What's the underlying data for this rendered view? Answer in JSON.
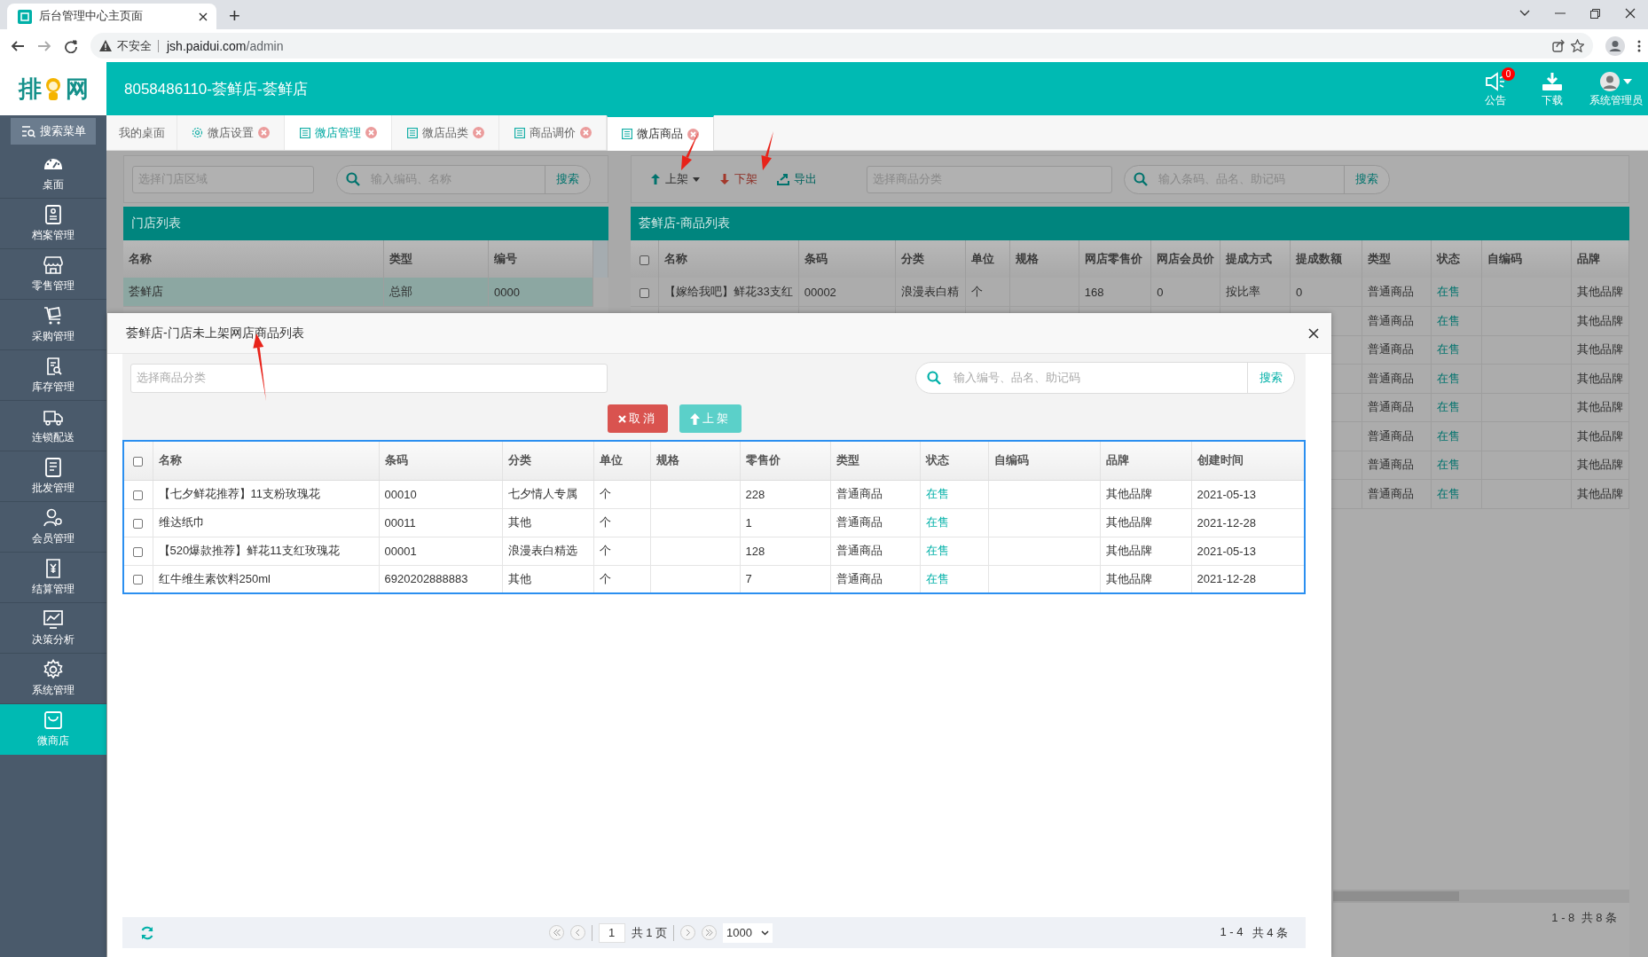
{
  "browser": {
    "tab_title": "后台管理中心主页面",
    "new_tab": "+",
    "security_label": "不安全",
    "url_host": "jsh.paidui.com",
    "url_path": "/admin"
  },
  "header": {
    "logo": [
      "排",
      "网"
    ],
    "title": "8058486110-荟鲜店-荟鲜店",
    "actions": [
      {
        "kind": "notice",
        "label": "公告",
        "badge": "0"
      },
      {
        "kind": "download",
        "label": "下载"
      },
      {
        "kind": "user",
        "label": "系统管理员"
      }
    ]
  },
  "sidebar": {
    "search_button": "搜索菜单",
    "items": [
      {
        "label": "桌面",
        "selected": false
      },
      {
        "label": "档案管理",
        "selected": false
      },
      {
        "label": "零售管理",
        "selected": false
      },
      {
        "label": "采购管理",
        "selected": false
      },
      {
        "label": "库存管理",
        "selected": false
      },
      {
        "label": "连锁配送",
        "selected": false
      },
      {
        "label": "批发管理",
        "selected": false
      },
      {
        "label": "会员管理",
        "selected": false
      },
      {
        "label": "结算管理",
        "selected": false
      },
      {
        "label": "决策分析",
        "selected": false
      },
      {
        "label": "系统管理",
        "selected": false
      },
      {
        "label": "微商店",
        "selected": true
      }
    ]
  },
  "tabs": [
    {
      "label": "我的桌面",
      "selected": false,
      "highlighted": false,
      "closable": false
    },
    {
      "label": "微店设置",
      "selected": false,
      "highlighted": false,
      "closable": true
    },
    {
      "label": "微店管理",
      "selected": false,
      "highlighted": true,
      "closable": true
    },
    {
      "label": "微店品类",
      "selected": false,
      "highlighted": false,
      "closable": true
    },
    {
      "label": "商品调价",
      "selected": false,
      "highlighted": false,
      "closable": true
    },
    {
      "label": "微店商品",
      "selected": true,
      "highlighted": false,
      "closable": true
    }
  ],
  "store_panel": {
    "region_placeholder": "选择门店区域",
    "search_placeholder": "输入编码、名称",
    "search_button": "搜索",
    "title": "门店列表",
    "columns": [
      "名称",
      "类型",
      "编号"
    ],
    "rows": [
      {
        "selected": true,
        "cells": [
          "荟鲜店",
          "总部",
          "0000"
        ]
      }
    ]
  },
  "product_panel": {
    "toolbar": [
      {
        "kind": "up",
        "label": "上架"
      },
      {
        "kind": "down",
        "label": "下架"
      },
      {
        "kind": "export",
        "label": "导出"
      }
    ],
    "category_placeholder": "选择商品分类",
    "search_placeholder": "输入条码、品名、助记码",
    "search_button": "搜索",
    "title": "荟鲜店-商品列表",
    "all_checked": false,
    "columns": [
      "名称",
      "条码",
      "分类",
      "单位",
      "规格",
      "网店零售价",
      "网店会员价",
      "提成方式",
      "提成数额",
      "类型",
      "状态",
      "自编码",
      "品牌"
    ],
    "rows": [
      {
        "checked": false,
        "cells": [
          "【嫁给我吧】鲜花33支红",
          "00002",
          "浪漫表白精",
          "个",
          "",
          "168",
          "0",
          "按比率",
          "0",
          "普通商品",
          "在售",
          "",
          "其他品牌"
        ]
      }
    ],
    "partly_hidden_rows": [
      {
        "type": "普通商品",
        "status": "在售",
        "brand": "其他品牌"
      },
      {
        "type": "普通商品",
        "status": "在售",
        "brand": "其他品牌"
      },
      {
        "type": "普通商品",
        "status": "在售",
        "brand": "其他品牌"
      },
      {
        "type": "普通商品",
        "status": "在售",
        "brand": "其他品牌"
      },
      {
        "type": "普通商品",
        "status": "在售",
        "brand": "其他品牌"
      },
      {
        "type": "普通商品",
        "status": "在售",
        "brand": "其他品牌"
      },
      {
        "type": "普通商品",
        "status": "在售",
        "brand": "其他品牌"
      }
    ],
    "summary": "1 - 8  共 8 条"
  },
  "dialog": {
    "title": "荟鲜店-门店未上架网店商品列表",
    "category_placeholder": "选择商品分类",
    "search_placeholder": "输入编号、品名、助记码",
    "search_button": "搜索",
    "buttons": [
      {
        "kind": "cancel",
        "label": "取消"
      },
      {
        "kind": "shelve",
        "label": "上架"
      }
    ],
    "all_checked": false,
    "columns": [
      "名称",
      "条码",
      "分类",
      "单位",
      "规格",
      "零售价",
      "类型",
      "状态",
      "自编码",
      "品牌",
      "创建时间"
    ],
    "rows": [
      {
        "checked": false,
        "cells": [
          "【七夕鲜花推荐】11支粉玫瑰花",
          "00010",
          "七夕情人专属",
          "个",
          "",
          "228",
          "普通商品",
          "在售",
          "",
          "其他品牌",
          "2021-05-13"
        ]
      },
      {
        "checked": false,
        "cells": [
          "维达纸巾",
          "00011",
          "其他",
          "个",
          "",
          "1",
          "普通商品",
          "在售",
          "",
          "其他品牌",
          "2021-12-28"
        ]
      },
      {
        "checked": false,
        "cells": [
          "【520爆款推荐】鲜花11支红玫瑰花",
          "00001",
          "浪漫表白精选",
          "个",
          "",
          "128",
          "普通商品",
          "在售",
          "",
          "其他品牌",
          "2021-05-13"
        ]
      },
      {
        "checked": false,
        "cells": [
          "红牛维生素饮料250ml",
          "6920202888883",
          "其他",
          "个",
          "",
          "7",
          "普通商品",
          "在售",
          "",
          "其他品牌",
          "2021-12-28"
        ]
      }
    ],
    "footer": {
      "page": "1",
      "page_total": "共 1 页",
      "page_size": "1000",
      "range": "1 - 4",
      "total": "共 4 条"
    }
  }
}
